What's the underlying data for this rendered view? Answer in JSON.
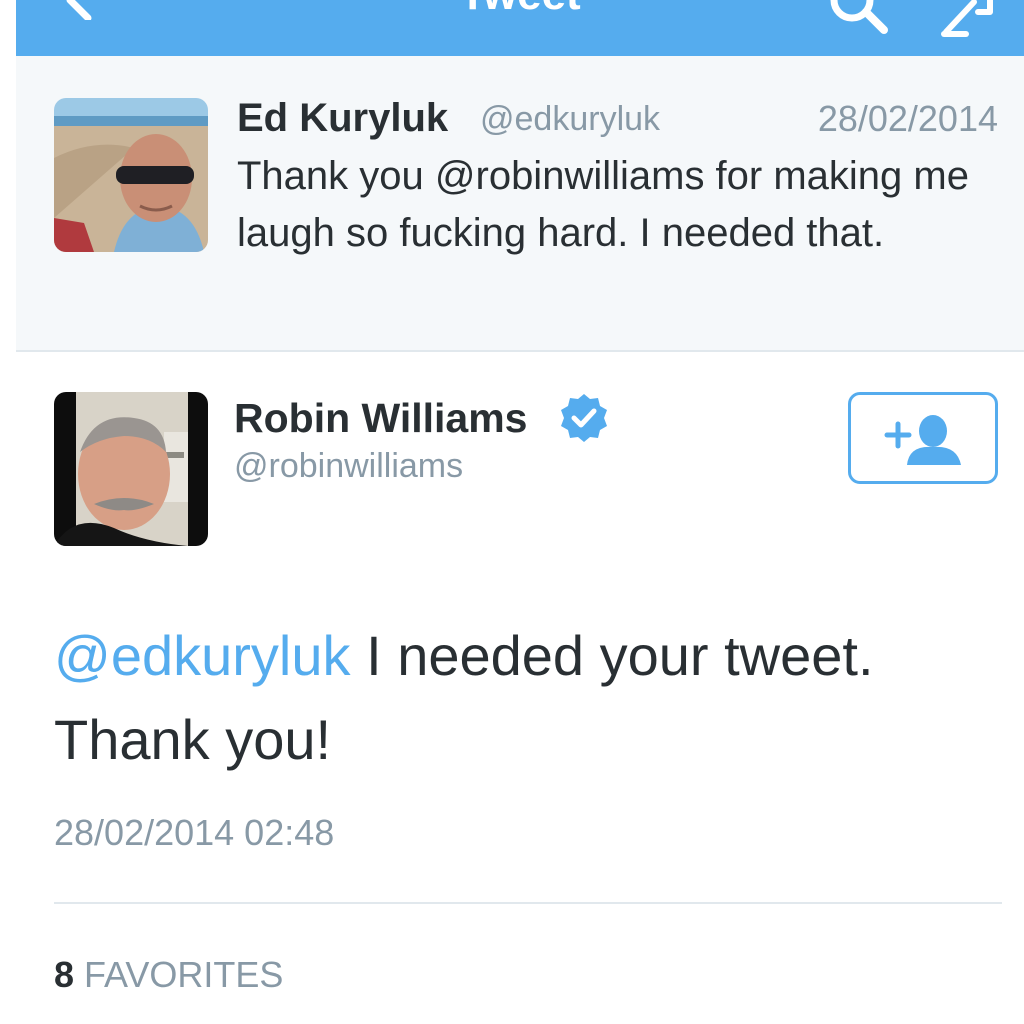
{
  "nav": {
    "title": "Tweet"
  },
  "parent_tweet": {
    "name": "Ed Kuryluk",
    "handle": "@edkuryluk",
    "date": "28/02/2014",
    "text": "Thank you @robinwilliams for making me laugh so fucking hard. I needed that."
  },
  "tweet": {
    "name": "Robin Williams",
    "handle": "@robinwilliams",
    "mention": "@edkuryluk",
    "text_line1": " I needed your tweet.",
    "text_line2": "Thank you!",
    "timestamp": "28/02/2014 02:48",
    "favorites_count": "8",
    "favorites_label": "FAVORITES"
  },
  "icons": {
    "back": "back-arrow-icon",
    "search": "search-icon",
    "compose": "compose-icon",
    "verified": "verified-badge-icon",
    "follow": "follow-user-icon"
  },
  "colors": {
    "accent": "#55acee",
    "text": "#292f33",
    "muted": "#8899a6",
    "parent_bg": "#f5f8fa",
    "divider": "#e1e8ed"
  }
}
